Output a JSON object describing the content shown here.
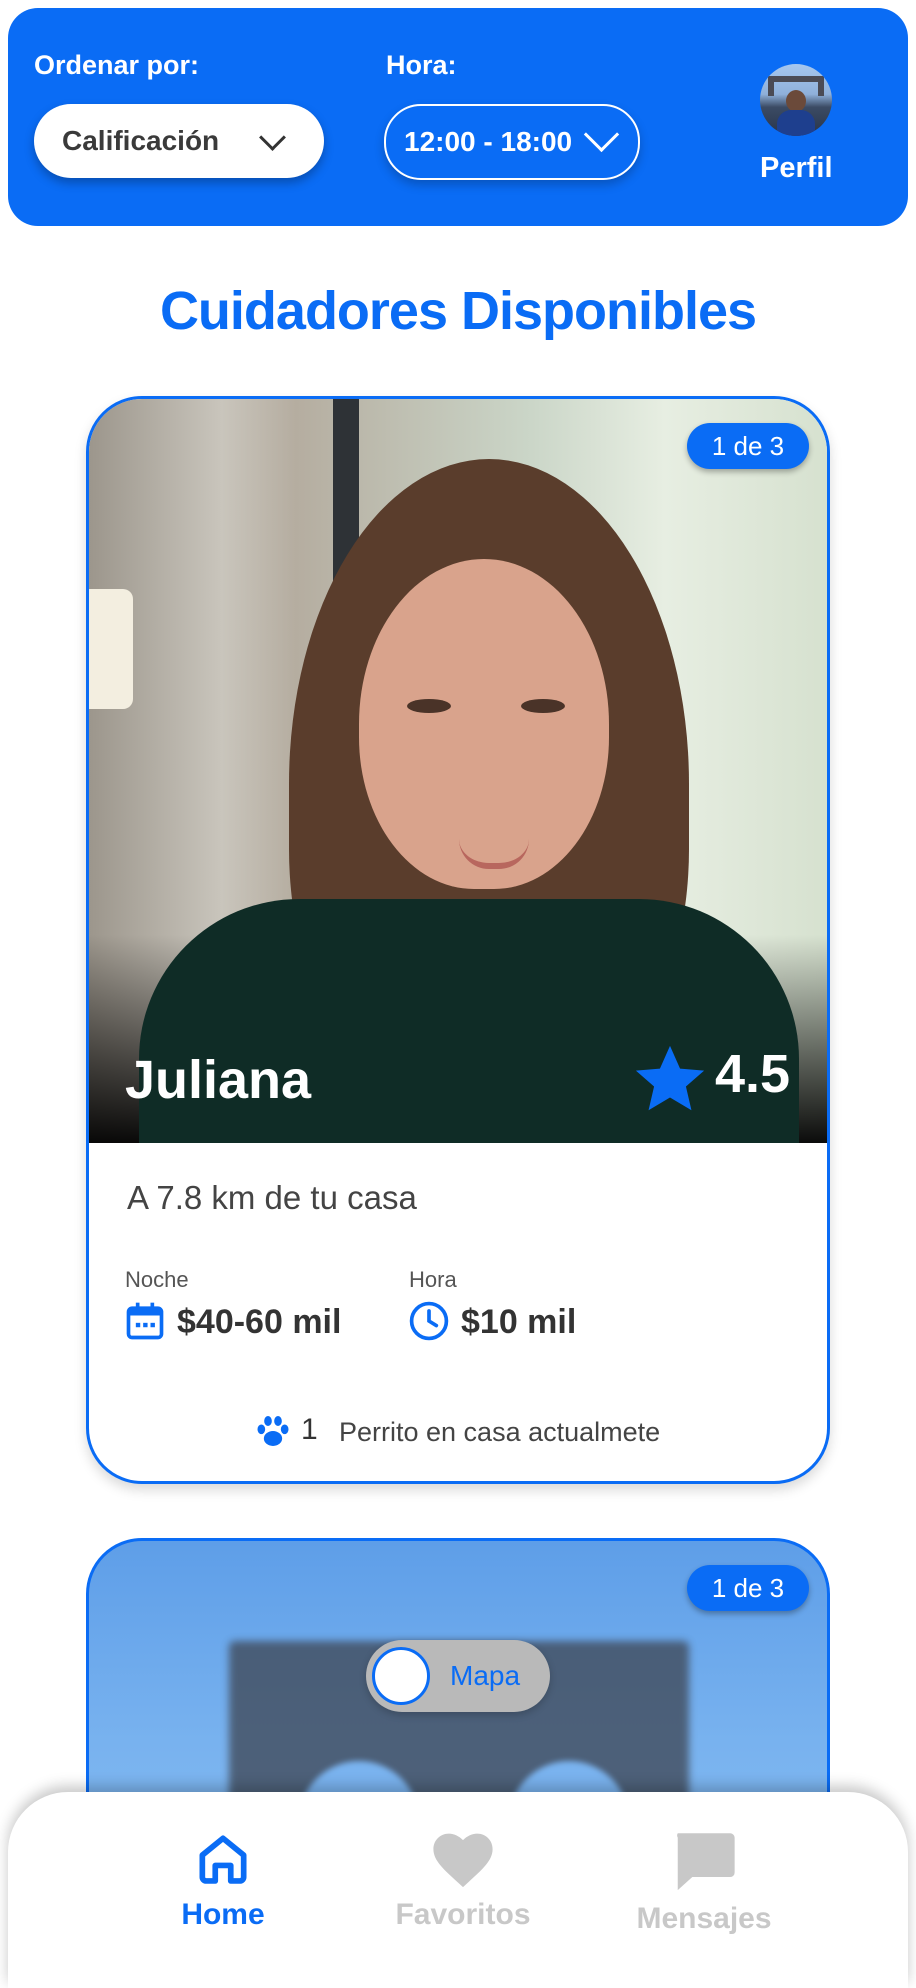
{
  "header": {
    "sort_label": "Ordenar por:",
    "sort_value": "Calificación",
    "time_label": "Hora:",
    "time_value": "12:00 - 18:00",
    "profile_label": "Perfil"
  },
  "section_title": "Cuidadores Disponibles",
  "cards": [
    {
      "photo_counter": "1 de 3",
      "name": "Juliana",
      "rating": "4.5",
      "distance": "A 7.8 km de tu casa",
      "night_label": "Noche",
      "night_price": "$40-60 mil",
      "hour_label": "Hora",
      "hour_price": "$10 mil",
      "dogs_count": "1",
      "dogs_text": "Perrito en casa actualmete"
    },
    {
      "photo_counter": "1 de 3"
    }
  ],
  "map_toggle": {
    "label": "Mapa",
    "on": false
  },
  "bottom_nav": [
    {
      "label": "Home",
      "icon": "home-icon",
      "active": true
    },
    {
      "label": "Favoritos",
      "icon": "heart-icon",
      "active": false
    },
    {
      "label": "Mensajes",
      "icon": "message-icon",
      "active": false
    }
  ],
  "colors": {
    "primary": "#0a6cf5",
    "inactive": "#c8c8c8",
    "text_dark": "#333333"
  }
}
